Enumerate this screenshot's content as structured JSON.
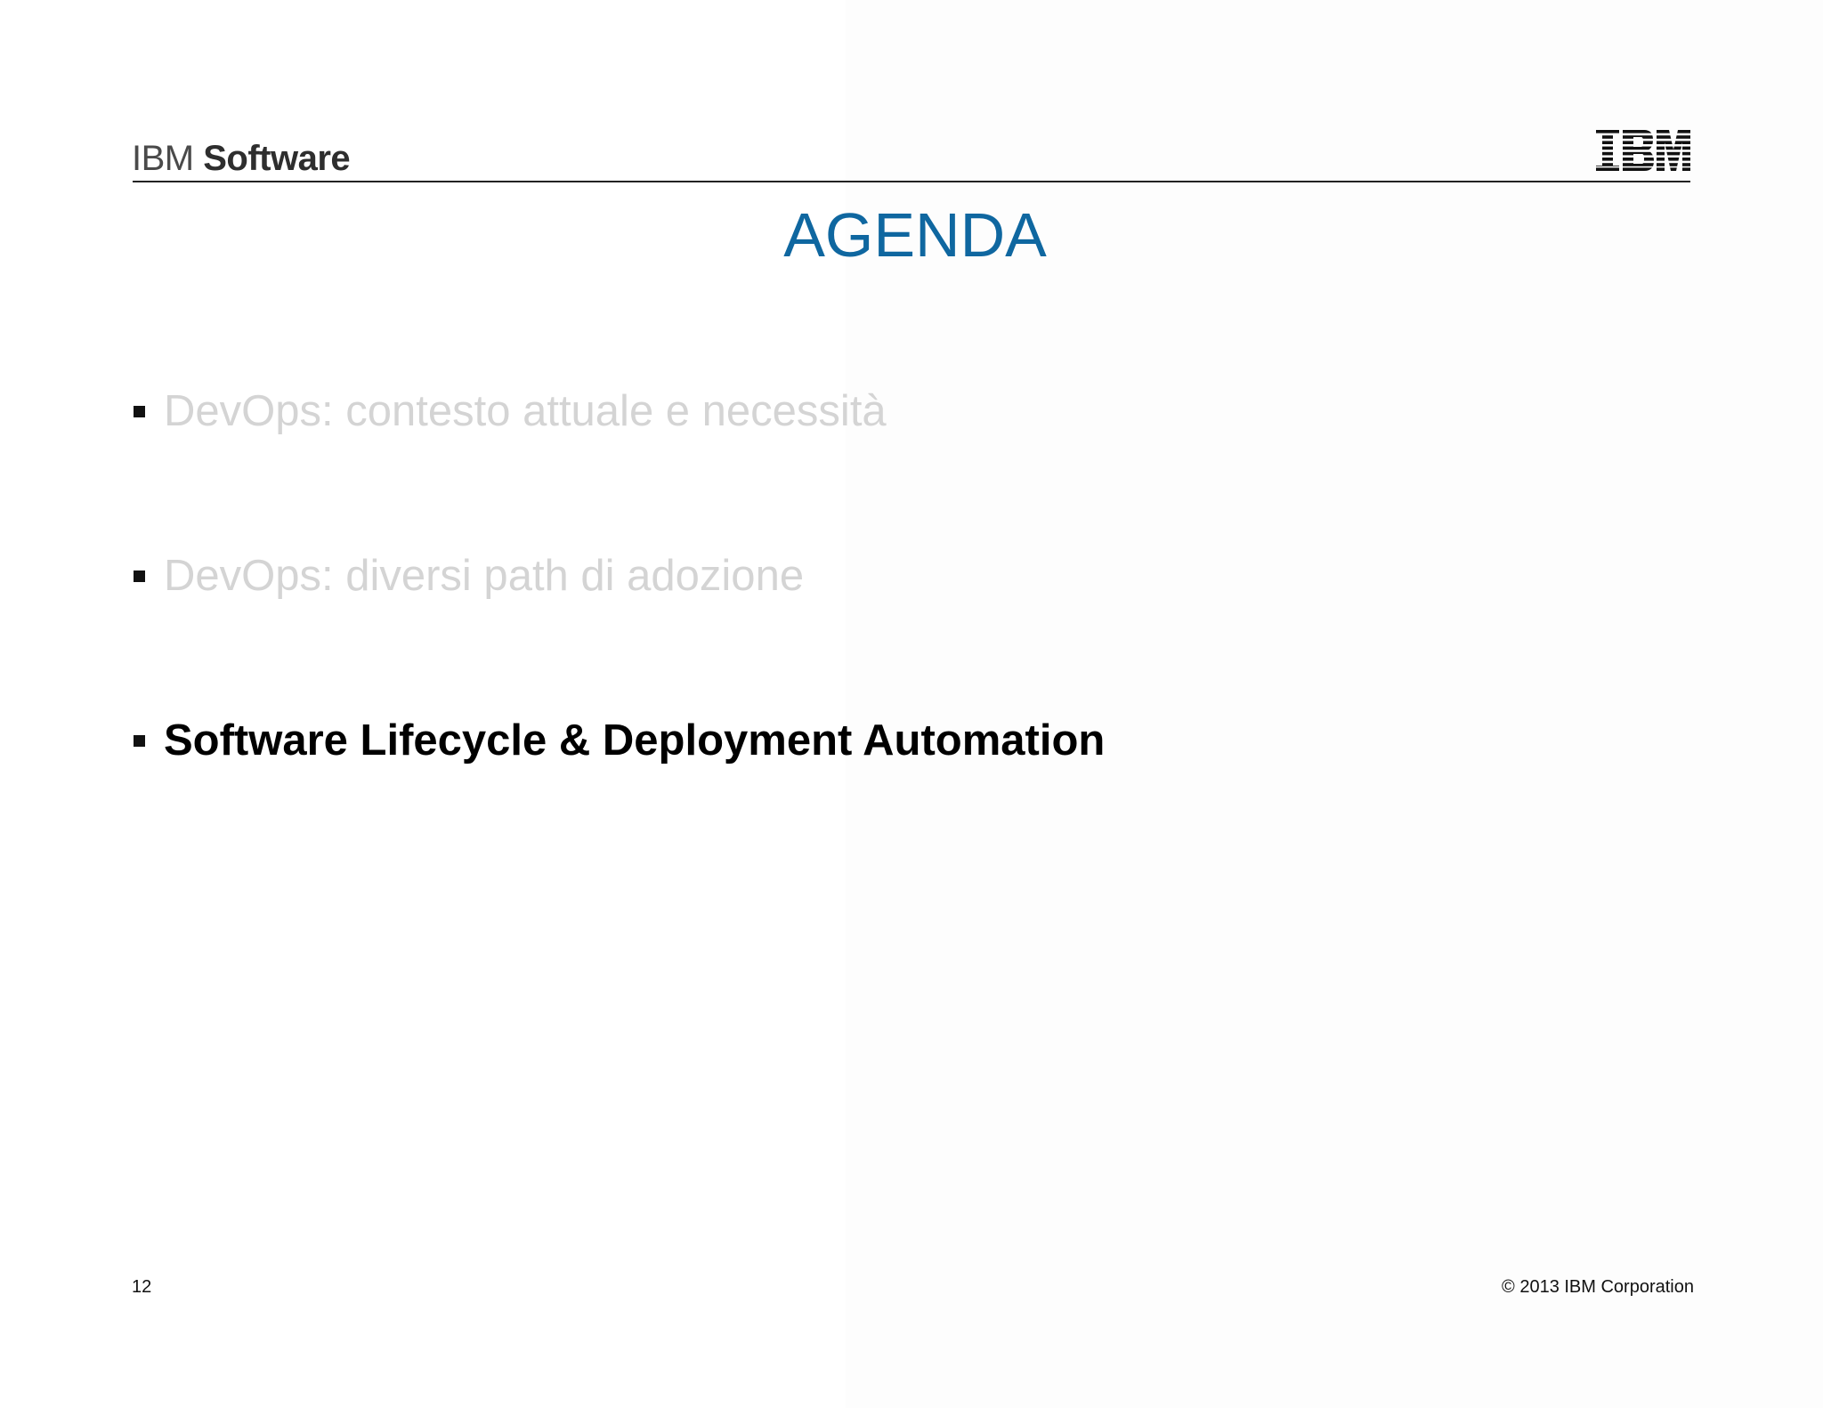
{
  "header": {
    "brand_prefix": "IBM",
    "brand_product": "Software",
    "logo_icon": "ibm-striped-logo-icon",
    "logo_text": "IBM"
  },
  "title": "AGENDA",
  "agenda": {
    "items": [
      {
        "label": "DevOps: contesto attuale e necessità",
        "state": "muted"
      },
      {
        "label": "DevOps: diversi path di adozione",
        "state": "muted"
      },
      {
        "label": "Software Lifecycle & Deployment Automation",
        "state": "active"
      }
    ]
  },
  "footer": {
    "page_number": "12",
    "copyright": "© 2013 IBM Corporation"
  },
  "colors": {
    "title": "#0f67a0",
    "muted_text": "#d4d4d4",
    "active_text": "#000000"
  }
}
